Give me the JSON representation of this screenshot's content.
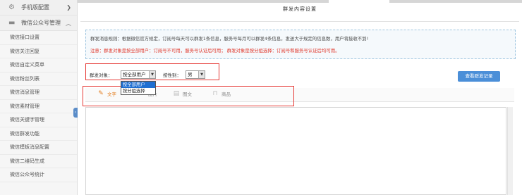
{
  "sidebar": {
    "groups": [
      {
        "label": "手机版配置",
        "icon": "gear-icon",
        "arrow": "chevron-down-icon"
      },
      {
        "label": "微信公众号管理",
        "icon": "chat-icon",
        "arrow": "chevron-up-icon"
      }
    ],
    "items": [
      {
        "label": "微信接口设置"
      },
      {
        "label": "微信关注回复"
      },
      {
        "label": "微信自定义菜单"
      },
      {
        "label": "微信粉丝列表"
      },
      {
        "label": "微信消息管理"
      },
      {
        "label": "微信素材管理"
      },
      {
        "label": "微信关键字管理"
      },
      {
        "label": "微信群发功能"
      },
      {
        "label": "微信模板消息配置"
      },
      {
        "label": "微信二维码生成"
      },
      {
        "label": "微信公众号统计"
      }
    ]
  },
  "page": {
    "title": "群发内容设置"
  },
  "notice": {
    "rule": "群发消息规则：根据微信官方规定，订阅号每天可以群发1条信息，服务号每月可以群发4条信息，发送大于规定的信息数，用户将接收不到!",
    "warning": "注意：群发对象是按全部用户：订阅号不可用，服务号认证后可用；    群发对象是按分组选择：订阅号和服务号认证后均可用。"
  },
  "form": {
    "target_label": "群发对象：",
    "target_value": "按全部用户",
    "target_options": [
      "按全部用户",
      "按分组选择"
    ],
    "gender_label": "按性别：",
    "gender_value": "男",
    "history_button": "查看群发记录"
  },
  "types": [
    {
      "label": "文字",
      "icon": "pencil-icon"
    },
    {
      "label": "图片",
      "icon": "image-icon"
    },
    {
      "label": "图文",
      "icon": "article-icon"
    },
    {
      "label": "商品",
      "icon": "bag-icon"
    }
  ],
  "colors": {
    "accent": "#4b8fd8",
    "warning": "#e0362a",
    "active_type": "#e37b1c",
    "highlight_box": "#e53935"
  }
}
